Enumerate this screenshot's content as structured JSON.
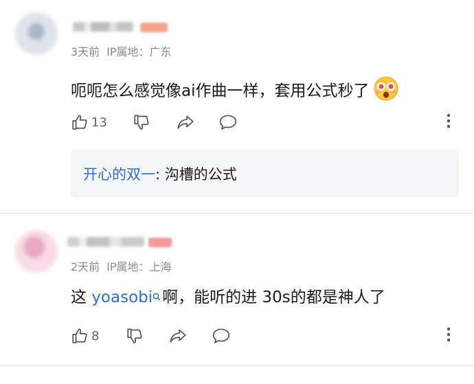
{
  "comments": [
    {
      "meta": {
        "time": "3天前",
        "ip": "IP属地：广东"
      },
      "content": {
        "text": "呃呃怎么感觉像ai作曲一样，套用公式秒了",
        "emoji": "astonished-face-emoji"
      },
      "actions": {
        "like_count": "13"
      },
      "reply": {
        "author": "开心的双一",
        "separator": ": ",
        "text": "沟槽的公式"
      }
    },
    {
      "meta": {
        "time": "2天前",
        "ip": "IP属地：上海"
      },
      "content": {
        "prefix": "这 ",
        "topic": "yoasobi",
        "suffix": "啊，能听的进 30s的都是神人了"
      },
      "actions": {
        "like_count": "8"
      }
    }
  ],
  "colors": {
    "link": "#2e6fd6",
    "meta": "#8a8a8a",
    "reply_bg": "#f5f6f8"
  }
}
